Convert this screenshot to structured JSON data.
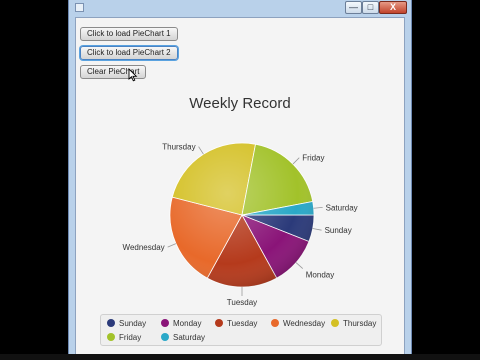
{
  "window": {
    "controls": {
      "minimize": "—",
      "maximize": "□",
      "close": "X"
    }
  },
  "buttons": {
    "load_pie_1": "Click to load PieChart 1",
    "load_pie_2": "Click to load PieChart 2",
    "clear_pie": "Clear PieChart"
  },
  "chart_data": {
    "type": "pie",
    "title": "Weekly Record",
    "slices": [
      {
        "label": "Sunday",
        "value": 6,
        "color": "#2b3a7a"
      },
      {
        "label": "Monday",
        "value": 11,
        "color": "#8a1478"
      },
      {
        "label": "Tuesday",
        "value": 16,
        "color": "#b53a1c"
      },
      {
        "label": "Wednesday",
        "value": 21,
        "color": "#e8692a"
      },
      {
        "label": "Thursday",
        "value": 24,
        "color": "#d4c024"
      },
      {
        "label": "Friday",
        "value": 19,
        "color": "#a2c22a"
      },
      {
        "label": "Saturday",
        "value": 3,
        "color": "#2aa8c8"
      }
    ],
    "start_angle_deg": 0,
    "direction": "clockwise-on-screen",
    "legend": "bottom"
  }
}
